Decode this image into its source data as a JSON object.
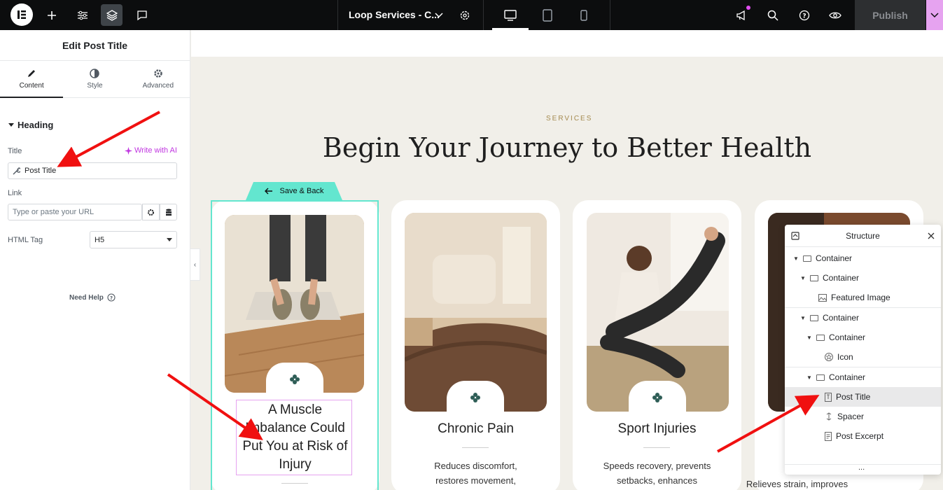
{
  "topbar": {
    "document_title": "Loop Services - C...",
    "publish_label": "Publish"
  },
  "panel": {
    "title": "Edit Post Title",
    "tabs": [
      {
        "label": "Content",
        "icon": "pencil-icon",
        "active": true
      },
      {
        "label": "Style",
        "icon": "contrast-icon",
        "active": false
      },
      {
        "label": "Advanced",
        "icon": "gear-icon",
        "active": false
      }
    ],
    "section": "Heading",
    "title_label": "Title",
    "ai_label": "Write with AI",
    "title_value": "Post Title",
    "link_label": "Link",
    "link_placeholder": "Type or paste your URL",
    "html_tag_label": "HTML Tag",
    "html_tag_value": "H5",
    "need_help": "Need Help"
  },
  "canvas": {
    "overline": "SERVICES",
    "headline": "Begin Your Journey to Better Health",
    "save_back": "Save & Back",
    "cards": [
      {
        "title": "A Muscle Imbalance Could Put You at Risk of Injury",
        "text": ""
      },
      {
        "title": "Chronic Pain",
        "text": "Reduces discomfort, restores movement,"
      },
      {
        "title": "Sport Injuries",
        "text": "Speeds recovery, prevents setbacks, enhances"
      },
      {
        "title": "",
        "text": "Relieves strain, improves"
      }
    ]
  },
  "structure": {
    "title": "Structure",
    "items": [
      {
        "label": "Container"
      },
      {
        "label": "Container"
      },
      {
        "label": "Featured Image"
      },
      {
        "label": "Container"
      },
      {
        "label": "Container"
      },
      {
        "label": "Icon"
      },
      {
        "label": "Container"
      },
      {
        "label": "Post Title"
      },
      {
        "label": "Spacer"
      },
      {
        "label": "Post Excerpt"
      }
    ],
    "more": "..."
  },
  "colors": {
    "accent_teal": "#63e6cf",
    "ai_pink": "#c036e0",
    "annotation_red": "#f01010"
  }
}
